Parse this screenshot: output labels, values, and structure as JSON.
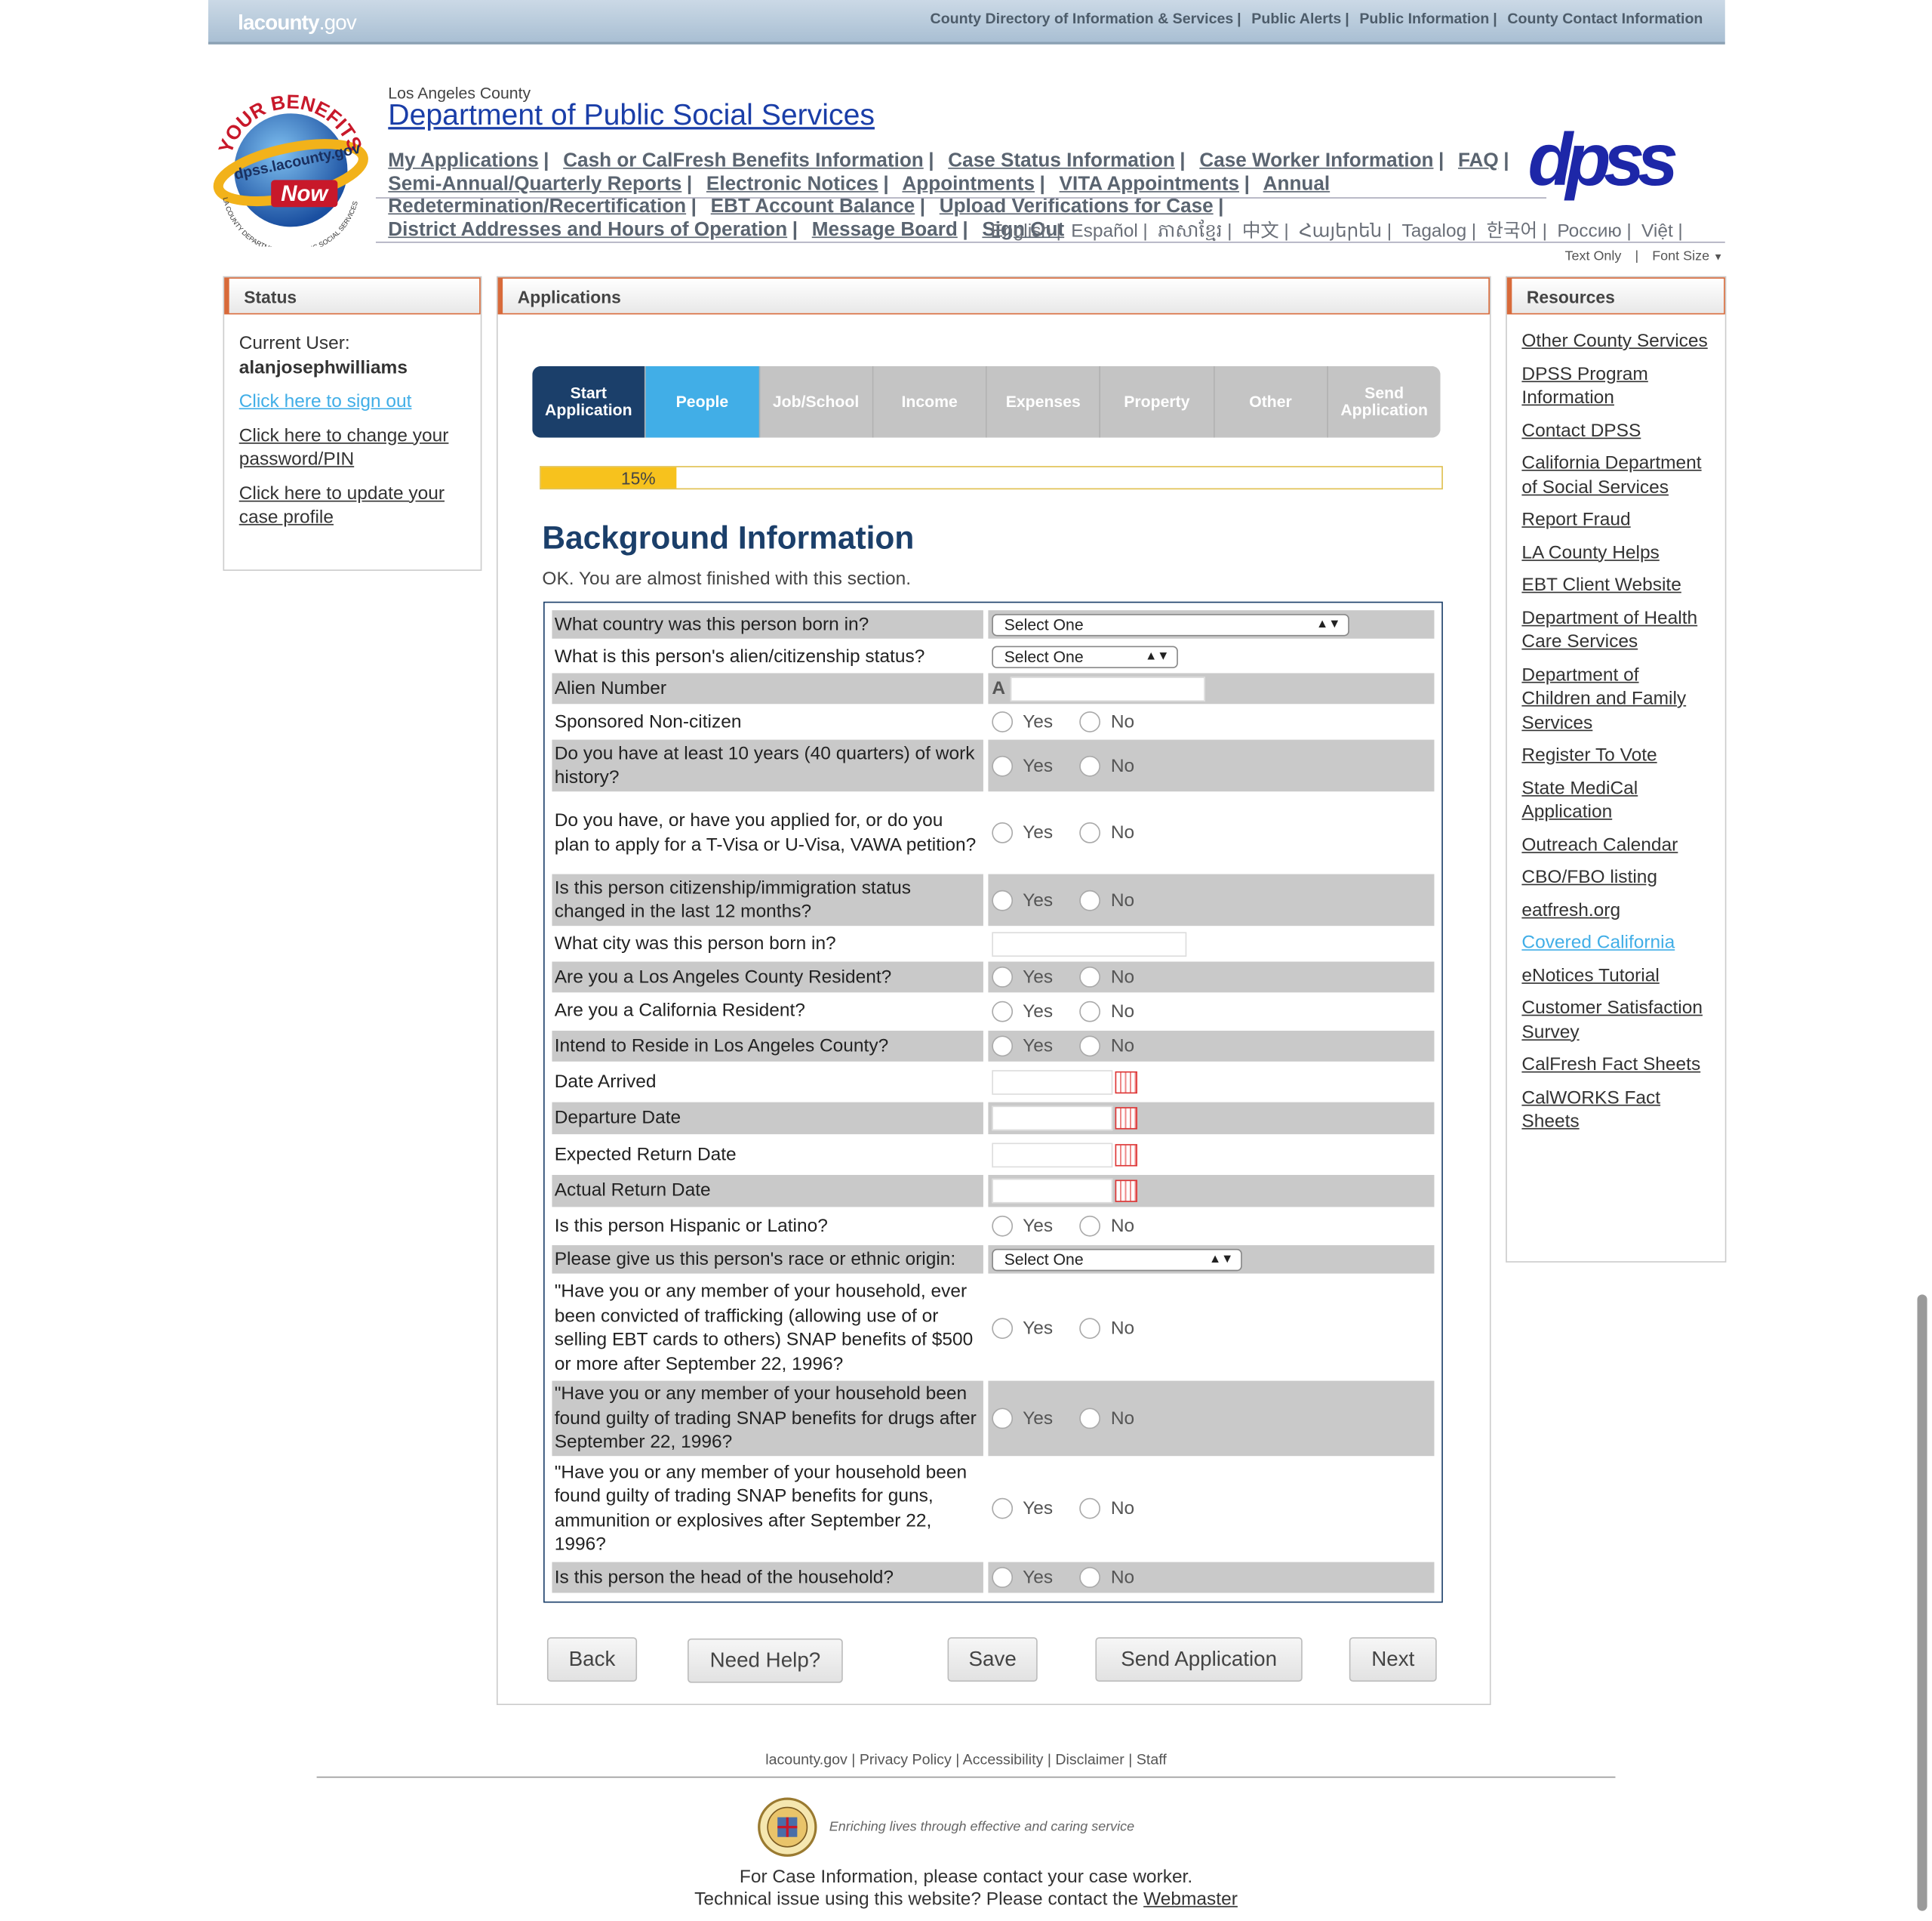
{
  "topbar": {
    "logo": "lacounty",
    "logo_suffix": ".gov",
    "links": [
      "County Directory of Information & Services",
      "Public Alerts",
      "Public Information",
      "County Contact Information"
    ]
  },
  "seal": {
    "text_top": "YOUR BENEFITS",
    "text_url": "dpss.lacounty.gov",
    "text_now": "Now",
    "text_ring": "LA COUNTY DEPARTMENT OF PUBLIC SOCIAL SERVICES"
  },
  "header": {
    "county": "Los Angeles County",
    "dept": "Department of Public Social Services",
    "logo_text": "dpss"
  },
  "nav": {
    "line1": [
      "My Applications",
      "Cash or CalFresh Benefits Information",
      "Case Status Information",
      "Case Worker Information",
      "FAQ"
    ],
    "line2": [
      "Semi-Annual/Quarterly Reports",
      "Electronic Notices",
      "Appointments",
      "VITA Appointments",
      "Annual"
    ],
    "line3": [
      "Redetermination/Recertification",
      "EBT Account Balance",
      "Upload Verifications for Case"
    ],
    "line4": [
      "District Addresses and Hours of Operation",
      "Message Board",
      "Sign Out"
    ]
  },
  "languages": [
    "English",
    "Español",
    "ភាសាខ្មែរ",
    "中文",
    "Հայերեն",
    "Tagalog",
    "한국어",
    "Россию",
    "Việt"
  ],
  "text_options": {
    "text_only": "Text Only",
    "font_size": "Font Size"
  },
  "status": {
    "title": "Status",
    "current_user_label": "Current User:",
    "username": "alanjosephwilliams",
    "sign_out": "Click here to sign out",
    "change_password": "Click here to change your password/PIN",
    "update_profile": "Click here to update your case profile"
  },
  "applications": {
    "title": "Applications"
  },
  "tabs": [
    "Start Application",
    "People",
    "Job/School",
    "Income",
    "Expenses",
    "Property",
    "Other",
    "Send Application"
  ],
  "progress": {
    "percent": 15,
    "label": "15%"
  },
  "form": {
    "heading": "Background Information",
    "subheading": "OK. You are almost finished with this section.",
    "yes": "Yes",
    "no": "No",
    "select_one": "Select One",
    "alien_prefix": "A",
    "questions": [
      "What country was this person born in?",
      "What is this person's alien/citizenship status?",
      "Alien Number",
      "Sponsored Non-citizen",
      "Do you have at least 10 years (40 quarters) of work history?",
      "Do you have, or have you applied for, or do you plan to apply for a T-Visa or U-Visa, VAWA petition?",
      "Is this person citizenship/immigration status changed in the last 12 months?",
      "What city was this person born in?",
      "Are you a Los Angeles County Resident?",
      "Are you a California Resident?",
      "Intend to Reside in Los Angeles County?",
      "Date Arrived",
      "Departure Date",
      "Expected Return Date",
      "Actual Return Date",
      "Is this person Hispanic or Latino?",
      "Please give us this person's race or ethnic origin:",
      "\"Have you or any member of your household, ever been convicted of trafficking (allowing use of or selling EBT cards to others) SNAP benefits of $500 or more after September 22, 1996?",
      "\"Have you or any member of your household been found guilty of trading SNAP benefits for drugs after September 22, 1996?",
      "\"Have you or any member of your household been found guilty of trading SNAP benefits for guns, ammunition or explosives after September 22, 1996?",
      "Is this person the head of the household?"
    ]
  },
  "buttons": {
    "back": "Back",
    "help": "Need Help?",
    "save": "Save",
    "send": "Send Application",
    "next": "Next"
  },
  "resources": {
    "title": "Resources",
    "links": [
      "Other County Services",
      "DPSS Program Information",
      "Contact DPSS",
      "California Department of Social Services",
      "Report Fraud",
      "LA County Helps",
      "EBT Client Website",
      "Department of Health Care Services",
      "Department of Children and Family Services",
      "Register To Vote",
      "State MediCal Application",
      "Outreach Calendar",
      "CBO/FBO listing",
      "eatfresh.org",
      "Covered California",
      "eNotices Tutorial",
      "Customer Satisfaction Survey",
      "CalFresh Fact Sheets",
      "CalWORKS Fact Sheets"
    ]
  },
  "footer": {
    "links": [
      "lacounty.gov",
      "Privacy Policy",
      "Accessibility",
      "Disclaimer",
      "Staff"
    ],
    "tagline": "Enriching lives through effective and caring service",
    "case_info": "For Case Information, please contact your case worker.",
    "tech_issue": "Technical issue using this website? Please contact the",
    "webmaster": "Webmaster"
  },
  "colors": {
    "accent_blue": "#1b3f6a",
    "active_tab": "#41aee7",
    "progress": "#f7c21d",
    "panel_border": "#d86a3a"
  }
}
